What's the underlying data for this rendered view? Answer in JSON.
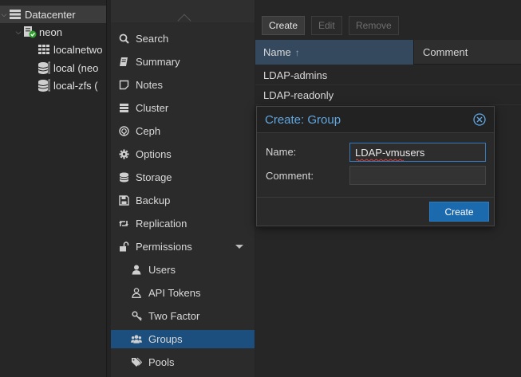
{
  "tree": {
    "datacenter": "Datacenter",
    "node": "neon",
    "items": [
      "localnetwo",
      "local (neo",
      "local-zfs ("
    ]
  },
  "nav": {
    "items": [
      {
        "label": "Search",
        "icon": "search-icon"
      },
      {
        "label": "Summary",
        "icon": "book-icon"
      },
      {
        "label": "Notes",
        "icon": "note-icon"
      },
      {
        "label": "Cluster",
        "icon": "server-icon"
      },
      {
        "label": "Ceph",
        "icon": "ceph-icon"
      },
      {
        "label": "Options",
        "icon": "gear-icon"
      },
      {
        "label": "Storage",
        "icon": "database-icon"
      },
      {
        "label": "Backup",
        "icon": "floppy-icon"
      },
      {
        "label": "Replication",
        "icon": "retweet-icon"
      },
      {
        "label": "Permissions",
        "icon": "unlock-icon"
      }
    ],
    "sub_items": [
      {
        "label": "Users",
        "icon": "user-icon"
      },
      {
        "label": "API Tokens",
        "icon": "user-outline-icon"
      },
      {
        "label": "Two Factor",
        "icon": "key-icon"
      },
      {
        "label": "Groups",
        "icon": "users-icon"
      },
      {
        "label": "Pools",
        "icon": "tags-icon"
      }
    ]
  },
  "toolbar": {
    "create": "Create",
    "edit": "Edit",
    "remove": "Remove"
  },
  "grid": {
    "columns": [
      "Name",
      "Comment"
    ],
    "rows": [
      "LDAP-admins",
      "LDAP-readonly"
    ]
  },
  "dialog": {
    "title": "Create: Group",
    "name_label": "Name:",
    "name_value": "LDAP-vmusers",
    "comment_label": "Comment:",
    "comment_value": "",
    "create_button": "Create"
  },
  "colors": {
    "accent": "#1c6aae",
    "title": "#5fa8e3",
    "selected_nav": "#1c4f7d"
  }
}
